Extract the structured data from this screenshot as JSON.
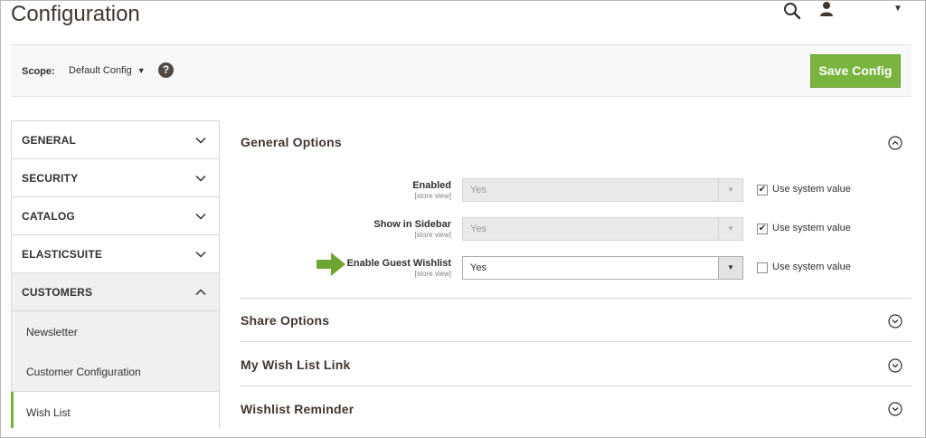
{
  "header": {
    "page_title": "Configuration"
  },
  "scope_bar": {
    "label": "Scope:",
    "selected": "Default Config",
    "help": "?",
    "save_label": "Save Config"
  },
  "tabs": {
    "items": [
      {
        "label": "GENERAL"
      },
      {
        "label": "SECURITY"
      },
      {
        "label": "CATALOG"
      },
      {
        "label": "ELASTICSUITE"
      },
      {
        "label": "CUSTOMERS"
      }
    ],
    "customers_subitems": [
      {
        "label": "Newsletter"
      },
      {
        "label": "Customer Configuration"
      },
      {
        "label": "Wish List"
      }
    ]
  },
  "sections": {
    "general": {
      "title": "General Options",
      "fields": [
        {
          "label": "Enabled",
          "scope": "[store view]",
          "value": "Yes",
          "checkbox_label": "Use system value"
        },
        {
          "label": "Show in Sidebar",
          "scope": "[store view]",
          "value": "Yes",
          "checkbox_label": "Use system value"
        },
        {
          "label": "Enable Guest Wishlist",
          "scope": "[store view]",
          "value": "Yes",
          "checkbox_label": "Use system value"
        }
      ]
    },
    "share": {
      "title": "Share Options"
    },
    "link": {
      "title": "My Wish List Link"
    },
    "reminder": {
      "title": "Wishlist Reminder"
    }
  },
  "colors": {
    "accent": "#79b43f",
    "title": "#41362f"
  }
}
